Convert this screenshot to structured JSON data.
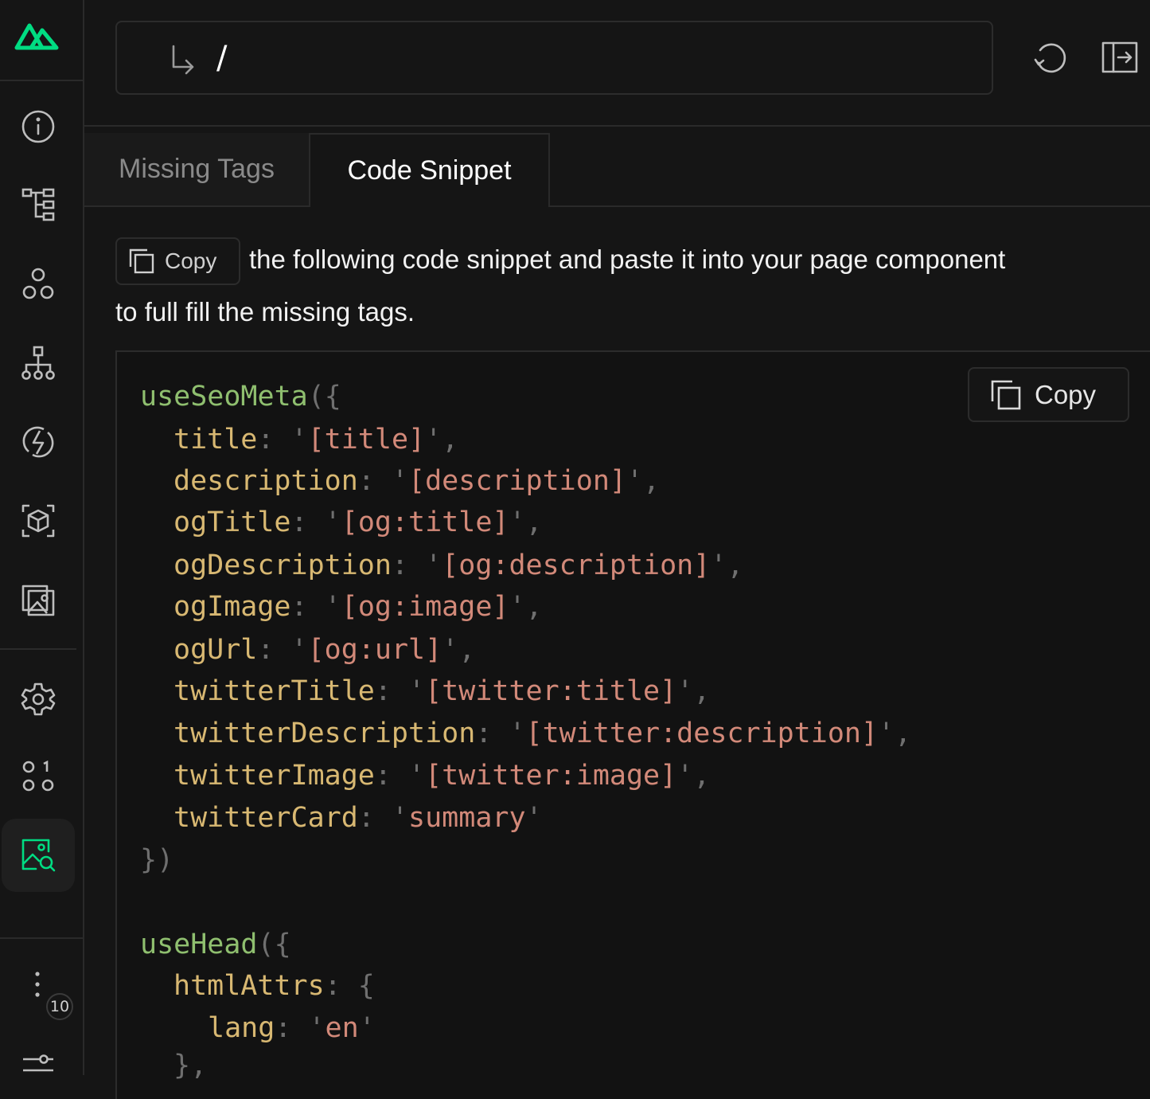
{
  "app": {
    "brand_color": "#00dc82",
    "logo_icon": "nuxt-logo-icon"
  },
  "sidebar": {
    "items": [
      {
        "name": "info-icon"
      },
      {
        "name": "components-tree-icon"
      },
      {
        "name": "components-icon"
      },
      {
        "name": "hierarchy-icon"
      },
      {
        "name": "hooks-icon"
      },
      {
        "name": "modules-icon"
      },
      {
        "name": "assets-icon"
      },
      {
        "name": "settings-icon"
      },
      {
        "name": "state-icon"
      },
      {
        "name": "open-graph-icon",
        "active": true
      }
    ],
    "badge": "10"
  },
  "topbar": {
    "route": "/",
    "route_icon": "corner-down-right-icon",
    "refresh_icon": "refresh-icon",
    "split_icon": "split-screen-icon"
  },
  "tabs": [
    {
      "label": "Missing Tags"
    },
    {
      "label": "Code Snippet",
      "active": true
    }
  ],
  "description": {
    "copy_label": "Copy",
    "line1": "the following code snippet and paste it into your page component",
    "line2": "to full fill the missing tags."
  },
  "code": {
    "copy_label": "Copy",
    "fn1": "useSeoMeta",
    "seo_entries": [
      {
        "key": "title",
        "value": "[title]"
      },
      {
        "key": "description",
        "value": "[description]"
      },
      {
        "key": "ogTitle",
        "value": "[og:title]"
      },
      {
        "key": "ogDescription",
        "value": "[og:description]"
      },
      {
        "key": "ogImage",
        "value": "[og:image]"
      },
      {
        "key": "ogUrl",
        "value": "[og:url]"
      },
      {
        "key": "twitterTitle",
        "value": "[twitter:title]"
      },
      {
        "key": "twitterDescription",
        "value": "[twitter:description]"
      },
      {
        "key": "twitterImage",
        "value": "[twitter:image]"
      },
      {
        "key": "twitterCard",
        "value": "summary"
      }
    ],
    "fn2": "useHead",
    "html_attrs_key": "htmlAttrs",
    "lang_key": "lang",
    "lang_value": "en"
  }
}
